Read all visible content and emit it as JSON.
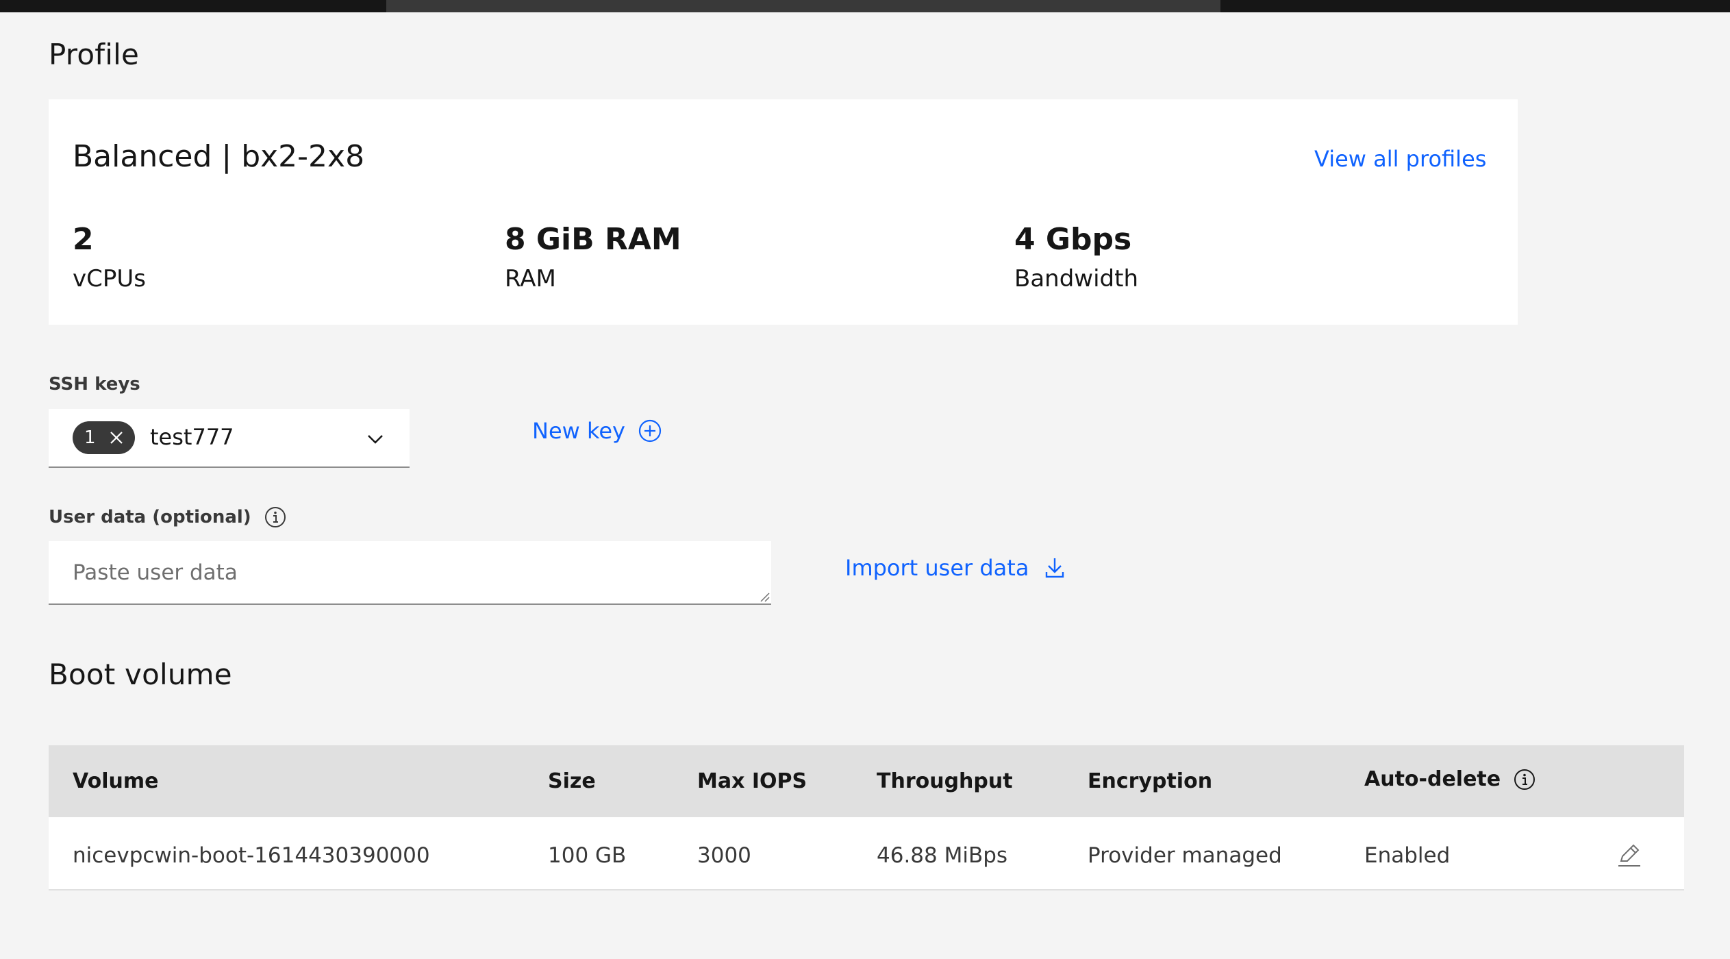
{
  "profile_section": {
    "heading": "Profile",
    "card": {
      "title": "Balanced | bx2-2x8",
      "view_all_link": "View all profiles",
      "stats": [
        {
          "value": "2",
          "label": "vCPUs"
        },
        {
          "value": "8 GiB RAM",
          "label": "RAM"
        },
        {
          "value": "4 Gbps",
          "label": "Bandwidth"
        }
      ]
    }
  },
  "ssh_keys": {
    "label": "SSH keys",
    "selected_count": "1",
    "selected_value": "test777",
    "new_key_link": "New key"
  },
  "user_data": {
    "label": "User data (optional)",
    "placeholder": "Paste user data",
    "import_link": "Import user data"
  },
  "boot_volume": {
    "heading": "Boot volume",
    "columns": [
      "Volume",
      "Size",
      "Max IOPS",
      "Throughput",
      "Encryption",
      "Auto-delete"
    ],
    "rows": [
      [
        "nicevpcwin-boot-1614430390000",
        "100 GB",
        "3000",
        "46.88 MiBps",
        "Provider managed",
        "Enabled"
      ]
    ]
  },
  "icons": {
    "tag_clear": "close-icon",
    "dropdown": "chevron-down-icon",
    "add": "add-circle-icon",
    "info": "information-icon",
    "download": "download-icon",
    "edit": "edit-icon"
  },
  "colors": {
    "link": "#0f62fe",
    "background": "#f4f4f4",
    "tag": "#393939"
  }
}
